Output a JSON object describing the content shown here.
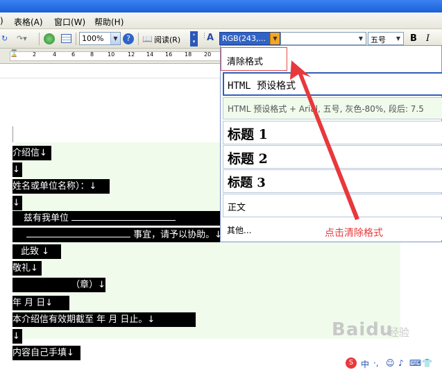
{
  "menubar": {
    "items": [
      "表格(A)",
      "窗口(W)",
      "帮助(H)"
    ]
  },
  "toolbar": {
    "zoom": "100%",
    "read_label": "阅读(R)",
    "font_color_value": "RGB(243,...",
    "font_size": "五号",
    "bold": "B",
    "italic": "I"
  },
  "ruler": {
    "ticks": [
      "2",
      "4",
      "6",
      "8",
      "10",
      "12",
      "14",
      "16",
      "18",
      "20"
    ]
  },
  "document": {
    "lines": [
      "介绍信↓",
      "↓",
      "姓名或单位名称）：↓",
      "↓",
      "兹有我单位",
      "事宜，请予以协助。↓",
      "此致 ↓",
      "敬礼↓",
      "（章）↓",
      "年  月  日↓",
      "本介绍信有效期截至    年  月  日止。↓",
      "↓",
      "内容自己手填↓"
    ]
  },
  "style_dropdown": {
    "items": [
      "清除格式",
      "HTML 预设格式",
      "HTML 预设格式 + Arial, 五号, 灰色-80%, 段后: 7.5",
      "标题 1",
      "标题 2",
      "标题 3",
      "正文",
      "其他..."
    ]
  },
  "annotation": {
    "text": "点击清除格式",
    "color": "#e8383c"
  },
  "watermark": {
    "brand": "Baidu",
    "sub": "经验"
  }
}
